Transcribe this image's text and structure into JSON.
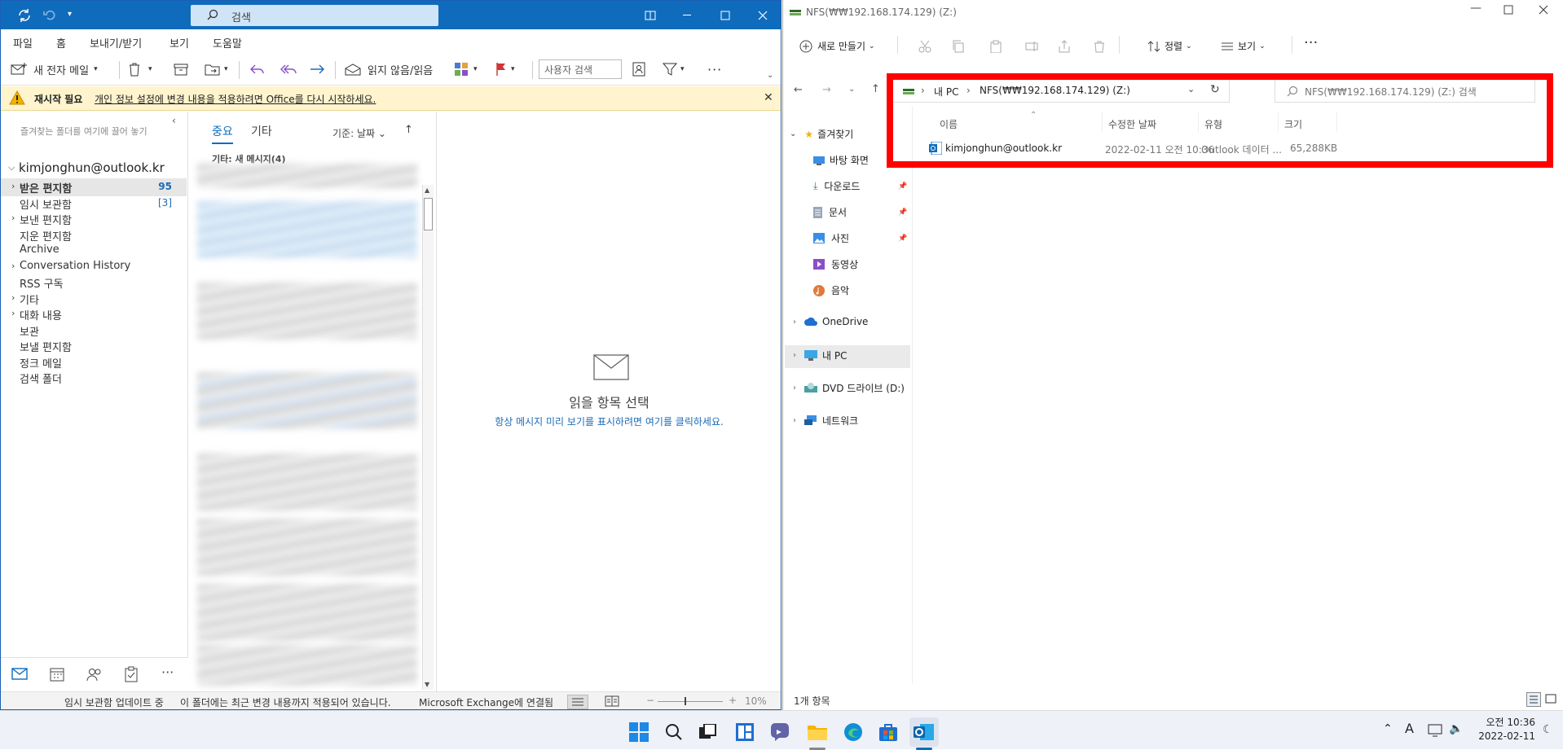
{
  "outlook": {
    "search_placeholder": "검색",
    "menu": [
      "파일",
      "홈",
      "보내기/받기",
      "보기",
      "도움말"
    ],
    "ribbon": {
      "new_mail": "새 전자 메일",
      "read_unread": "읽지 않음/읽음",
      "people_search": "사용자 검색"
    },
    "warning": {
      "label": "재시작 필요",
      "message": "개인 정보 설정에 변경 내용을 적용하려면 Office를 다시 시작하세요."
    },
    "favorites_hint": "즐겨찾는 폴더를 여기에 끌어 놓기",
    "account": "kimjonghun@outlook.kr",
    "folders": [
      {
        "label": "받은 편지함",
        "count": "95",
        "bold": true,
        "expand": true
      },
      {
        "label": "임시 보관함",
        "count": "[3]",
        "expand": false
      },
      {
        "label": "보낸 편지함",
        "count": "",
        "expand": true
      },
      {
        "label": "지운 편지함",
        "count": "",
        "expand": false
      },
      {
        "label": "Archive",
        "count": "",
        "expand": false
      },
      {
        "label": "Conversation History",
        "count": "",
        "expand": true
      },
      {
        "label": "RSS 구독",
        "count": "",
        "expand": false
      },
      {
        "label": "기타",
        "count": "",
        "expand": true
      },
      {
        "label": "대화 내용",
        "count": "",
        "expand": true
      },
      {
        "label": "보관",
        "count": "",
        "expand": false
      },
      {
        "label": "보낼 편지함",
        "count": "",
        "expand": false
      },
      {
        "label": "정크 메일",
        "count": "",
        "expand": false
      },
      {
        "label": "검색 폴더",
        "count": "",
        "expand": false
      }
    ],
    "list": {
      "tab_focused": "중요",
      "tab_other": "기타",
      "sort": "기준: 날짜",
      "group_header": "기타: 새 메시지(4)"
    },
    "reading": {
      "title": "읽을 항목 선택",
      "link": "항상 메시지 미리 보기를 표시하려면 여기를 클릭하세요."
    },
    "status": {
      "left": "임시 보관함 업데이트 중",
      "middle": "이 폴더에는 최근 변경 내용까지 적용되어 있습니다.",
      "connection": "Microsoft Exchange에 연결됨",
      "zoom": "10%"
    }
  },
  "explorer": {
    "title": "NFS(₩₩192.168.174.129) (Z:)",
    "cmd": {
      "new": "새로 만들기",
      "sort": "정렬",
      "view": "보기"
    },
    "breadcrumb": [
      "내 PC",
      "NFS(₩₩192.168.174.129) (Z:)"
    ],
    "search_placeholder": "NFS(₩₩192.168.174.129) (Z:) 검색",
    "nav": {
      "favorites": "즐겨찾기",
      "desktop": "바탕 화면",
      "downloads": "다운로드",
      "documents": "문서",
      "pictures": "사진",
      "videos": "동영상",
      "music": "음악",
      "onedrive": "OneDrive",
      "this_pc": "내 PC",
      "dvd": "DVD 드라이브 (D:)",
      "network": "네트워크"
    },
    "columns": {
      "name": "이름",
      "modified": "수정한 날짜",
      "type": "유형",
      "size": "크기"
    },
    "files": [
      {
        "name": "kimjonghun@outlook.kr",
        "modified": "2022-02-11 오전 10:36",
        "type": "Outlook 데이터 ...",
        "size": "65,288KB"
      }
    ],
    "status": "1개 항목"
  },
  "taskbar": {
    "time": "오전 10:36",
    "date": "2022-02-11",
    "ime": "A"
  }
}
